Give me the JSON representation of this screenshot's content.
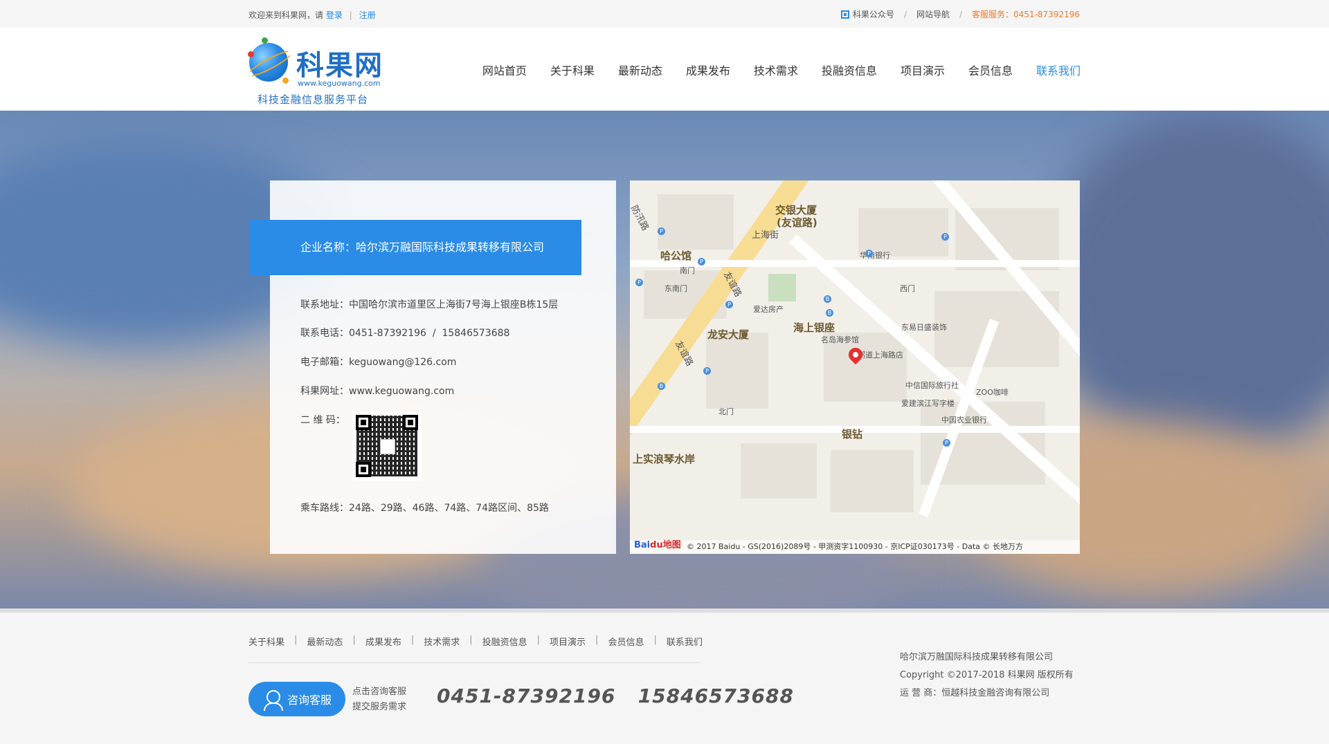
{
  "topbar": {
    "welcome": "欢迎来到科果网，请",
    "login": "登录",
    "register": "注册",
    "wechat": "科果公众号",
    "sitenav": "网站导航",
    "service": "客服服务：0451-87392196"
  },
  "logo": {
    "name": "科果网",
    "url": "www.keguowang.com",
    "slogan": "科技金融信息服务平台"
  },
  "nav": [
    "网站首页",
    "关于科果",
    "最新动态",
    "成果发布",
    "技术需求",
    "投融资信息",
    "项目演示",
    "会员信息",
    "联系我们"
  ],
  "contact": {
    "company": "企业名称：哈尔滨万融国际科技成果转移有限公司",
    "address": "联系地址：中国哈尔滨市道里区上海街7号海上银座B栋15层",
    "phone": "联系电话：0451-87392196  /  15846573688",
    "email": "电子邮箱：keguowang@126.com",
    "website": "科果网址：www.keguowang.com",
    "qrcode_label": "二 维 码：",
    "bus": "乘车路线：24路、29路、46路、74路、74路区间、85路"
  },
  "map": {
    "labels": {
      "hagongguan": "哈公馆",
      "jiaoyin": "交银大厦",
      "youyilu_paren": "(友谊路)",
      "shanghaijie": "上海街",
      "longan": "龙安大厦",
      "haishang": "海上银座",
      "yinzuo": "银钻",
      "shangshi": "上实浪琴水岸",
      "youyilu1": "友谊路",
      "youyilu2": "友谊路",
      "fangchuan": "防汛路",
      "nanmen": "南门",
      "dongnanmen": "东南门",
      "beimen": "北门",
      "ximen": "西门",
      "mingdao": "名岛海参馆",
      "aida": "爱达房产",
      "huanan": "华南银行",
      "zhenzhou": "珍粥道上海路店",
      "dongyi": "东易日盛装饰",
      "zhongxin": "中信国际旅行社",
      "aijian": "爱建滨江写字楼",
      "nongye": "中国农业银行",
      "zoo": "ZOO咖啡"
    },
    "footer": "© 2017 Baidu - GS(2016)2089号 - 甲测资字1100930 - 京ICP证030173号 - Data © 长地万方",
    "brand_a": "Bai",
    "brand_b": "du地图"
  },
  "footer": {
    "links": [
      "关于科果",
      "最新动态",
      "成果发布",
      "技术需求",
      "投融资信息",
      "项目演示",
      "会员信息",
      "联系我们"
    ],
    "consult_btn": "咨询客服",
    "consult_line1": "点击咨询客服",
    "consult_line2": "提交服务需求",
    "phones": "0451-87392196   15846573688",
    "company": "哈尔滨万融国际科技成果转移有限公司",
    "copyright": "Copyright ©2017-2018 科果网 版权所有",
    "operator": "运 营 商：恒越科技金融咨询有限公司"
  },
  "colors": {
    "accent": "#2a8ce6",
    "hot": "#f0792c"
  }
}
